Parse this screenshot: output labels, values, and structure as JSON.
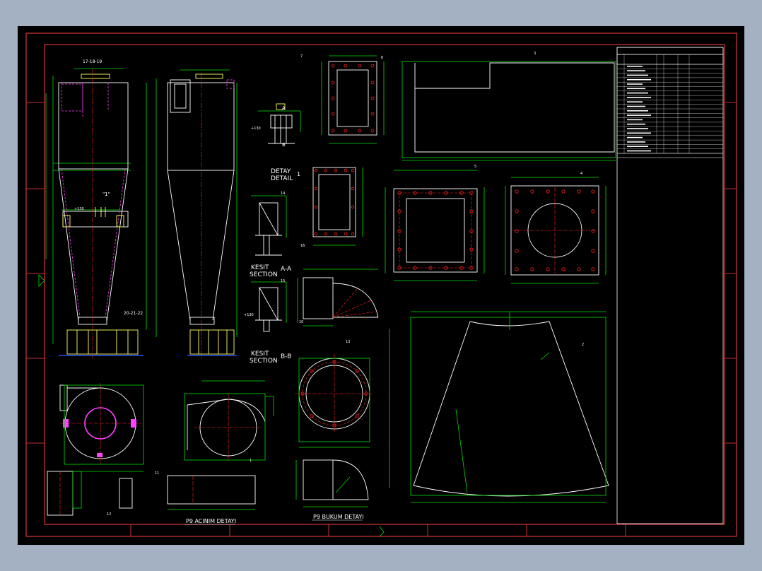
{
  "colors": {
    "background": "#a3b1c2",
    "sheet": "#000000",
    "frame": "#ff4040",
    "outline": "#00e000",
    "part": "#ffffff",
    "center": "#ff2020",
    "hidden": "#ff40ff",
    "yellow": "#ffff60"
  },
  "labels": {
    "detay": "DETAY",
    "detail": "DETAIL",
    "detail_no": "1",
    "kesit_a": "KESIT",
    "section_a": "SECTION",
    "section_a_id": "A-A",
    "kesit_b": "KESIT",
    "section_b": "SECTION",
    "section_b_id": "B-B",
    "p9_acinim": "P9 ACINIM DETAYI",
    "p9_bukum": "P9 BUKUM DETAYI",
    "detail_tag": "\"1\"",
    "section_mark_a": "A",
    "section_mark_b": "B",
    "part_refs": [
      "17-18-19",
      "20-21-22",
      "1",
      "2",
      "3",
      "4",
      "5",
      "6",
      "7",
      "10",
      "11",
      "12",
      "13",
      "14",
      "15",
      "16"
    ],
    "elevations": [
      "+130",
      "+130",
      "+130"
    ]
  },
  "title_block": {
    "rows": 20
  }
}
